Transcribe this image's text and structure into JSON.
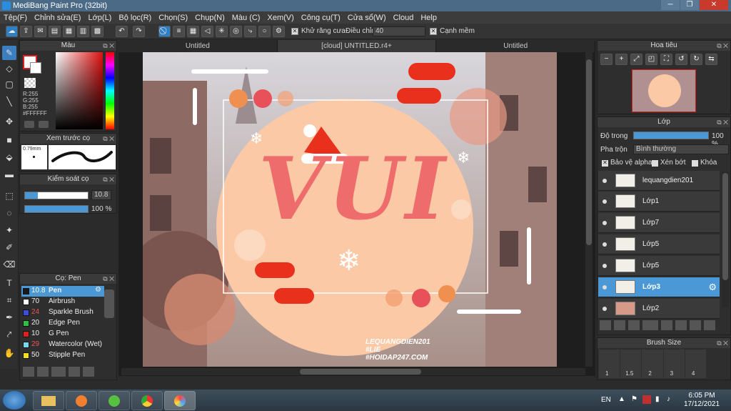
{
  "window": {
    "title": "MediBang Paint Pro (32bit)"
  },
  "menu": [
    "Tệp(F)",
    "Chỉnh sửa(E)",
    "Lớp(L)",
    "Bộ lọc(R)",
    "Chọn(S)",
    "Chụp(N)",
    "Màu (C)",
    "Xem(V)",
    "Công cụ(T)",
    "Cửa sổ(W)",
    "Cloud",
    "Help"
  ],
  "toolbar": {
    "antialias_label": "Khử răng cưa",
    "adjust_label": "Điều chỉnh",
    "adjust_value": "40",
    "snap_label": "Cạnh mềm"
  },
  "color_panel": {
    "title": "Màu",
    "r": "R:255",
    "g": "G:255",
    "b": "B:255",
    "hex": "#FFFFFF"
  },
  "brush_preview": {
    "title": "Xem trước cọ",
    "size": "0.79mm"
  },
  "brush_control": {
    "title": "Kiểm soát cọ",
    "size": "10.8",
    "opacity": "100 %"
  },
  "brush_list": {
    "title": "Cọ: Pen",
    "items": [
      {
        "size": "10.8",
        "name": "Pen",
        "color": "#1a1a1a"
      },
      {
        "size": "70",
        "name": "Airbrush",
        "color": "#ffffff"
      },
      {
        "size": "24",
        "name": "Sparkle Brush",
        "color": "#3d4de0"
      },
      {
        "size": "20",
        "name": "Edge Pen",
        "color": "#2ec043"
      },
      {
        "size": "10",
        "name": "G Pen",
        "color": "#e02020"
      },
      {
        "size": "29",
        "name": "Watercolor (Wet)",
        "color": "#7ad6f0"
      },
      {
        "size": "50",
        "name": "Stipple Pen",
        "color": "#f0e020"
      }
    ]
  },
  "tabs": [
    "Untitled",
    "[cloud] UNTITLED.r4+",
    "Untitled"
  ],
  "artwork": {
    "text": "VUI",
    "credit1": "LEQUANGDIEN201",
    "credit2": "#LIE",
    "credit3": "#HOIDAP247.COM"
  },
  "navigator": {
    "title": "Hoa tiêu"
  },
  "layer_panel": {
    "title": "Lớp",
    "opacity_label": "Độ trong",
    "opacity_value": "100 %",
    "blend_label": "Pha trộn",
    "blend_value": "Bình thường",
    "alpha_label": "Bảo vệ alpha",
    "clip_label": "Xén bớt",
    "lock_label": "Khóa",
    "layers": [
      "lequangdien201",
      "Lớp1",
      "Lớp7",
      "Lớp5",
      "Lớp5",
      "Lớp3",
      "Lớp2"
    ]
  },
  "brush_size": {
    "title": "Brush Size",
    "sizes": [
      "1",
      "1.5",
      "2",
      "3",
      "4"
    ]
  },
  "taskbar": {
    "lang": "EN",
    "time": "6:05 PM",
    "date": "17/12/2021"
  }
}
